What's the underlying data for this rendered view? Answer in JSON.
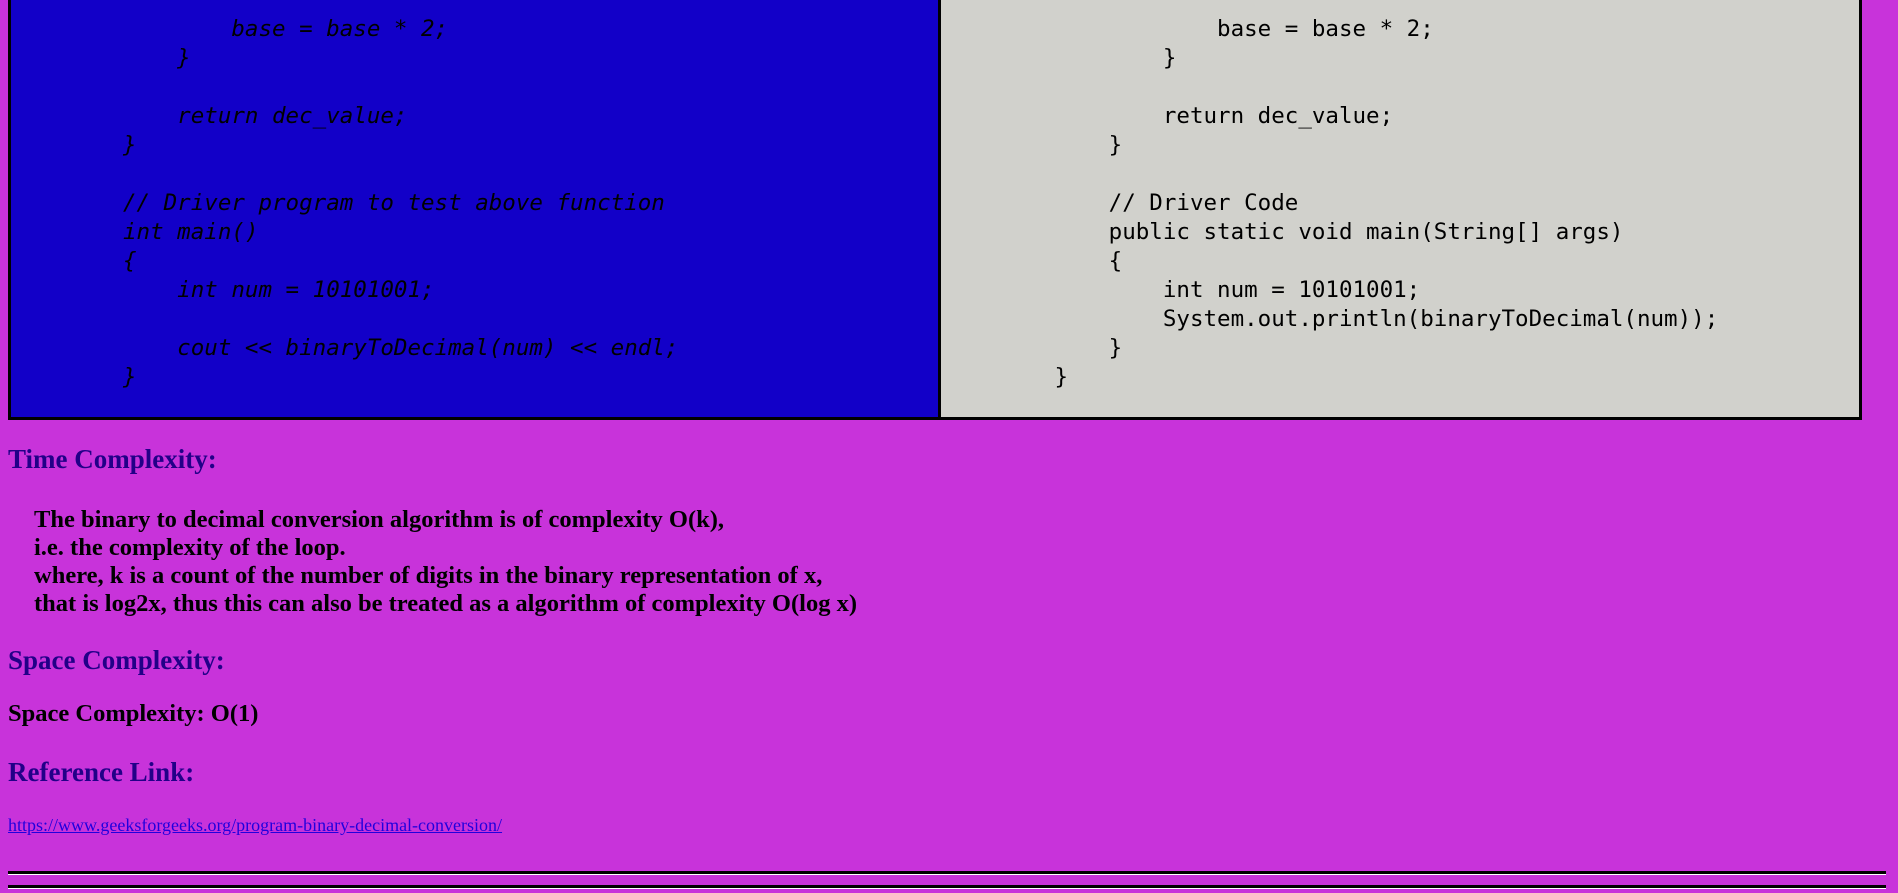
{
  "code": {
    "cpp_lines": [
      "        base = base * 2;",
      "    }",
      "",
      "    return dec_value;",
      "}",
      "",
      "// Driver program to test above function",
      "int main()",
      "{",
      "    int num = 10101001;",
      "",
      "    cout << binaryToDecimal(num) << endl;",
      "}"
    ],
    "java_lines": [
      "            base = base * 2;",
      "        }",
      "",
      "        return dec_value;",
      "    }",
      "",
      "    // Driver Code",
      "    public static void main(String[] args)",
      "    {",
      "        int num = 10101001;",
      "        System.out.println(binaryToDecimal(num));",
      "    }",
      "}"
    ]
  },
  "time_complexity": {
    "heading": "Time Complexity:",
    "lines": [
      "The binary to decimal conversion algorithm is of complexity O(k),",
      "i.e. the complexity of the loop.",
      "where, k is a count of the number of digits in the binary representation of x,",
      "that is log2x, thus this can also be treated as a algorithm of complexity O(log x)"
    ]
  },
  "space_complexity": {
    "heading": "Space Complexity:",
    "value": "Space Complexity: O(1)"
  },
  "reference": {
    "heading": "Reference Link:",
    "link": "https://www.geeksforgeeks.org/program-binary-decimal-conversion/"
  },
  "colors": {
    "page_background": "#c833da",
    "cpp_panel_background": "#1200c8",
    "java_panel_background": "#d1d1cc",
    "heading_color": "#220088",
    "link_color": "#2200dd"
  }
}
